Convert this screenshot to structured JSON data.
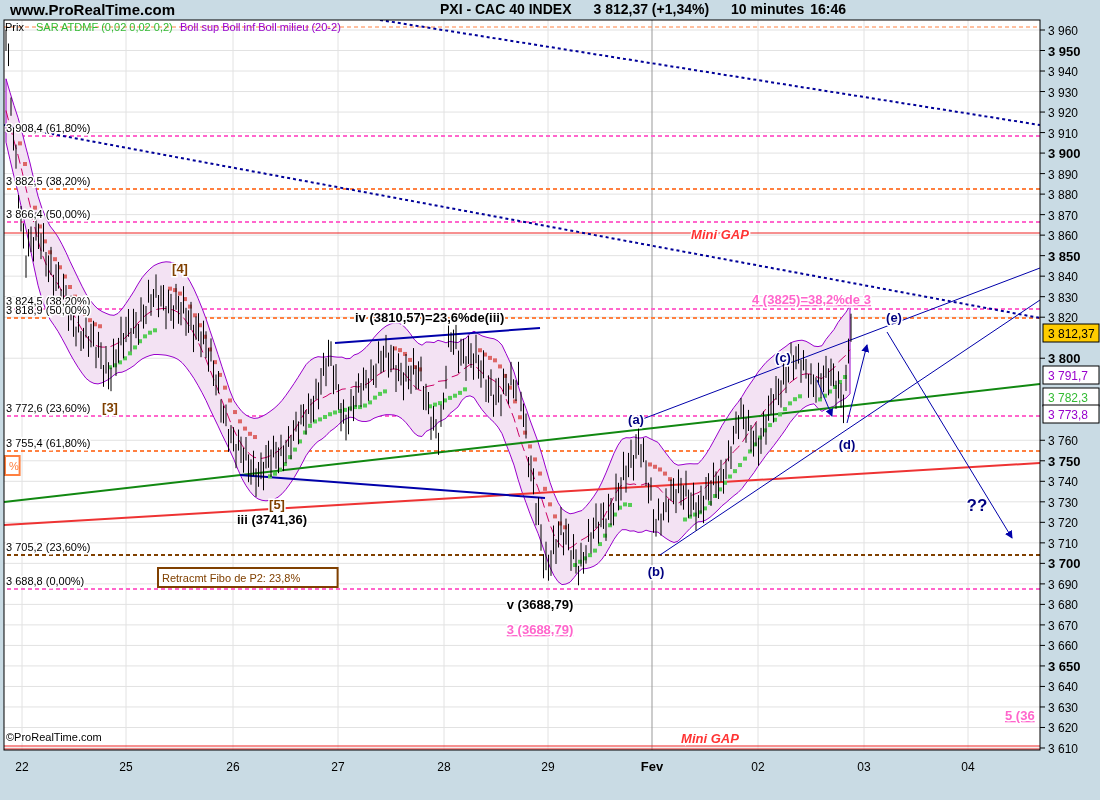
{
  "header": {
    "site": "www.ProRealTime.com",
    "title": "PXI - CAC 40 INDEX",
    "price": "3 812,37 (+1,34%)",
    "interval": "10 minutes",
    "time": "16:46"
  },
  "legend": {
    "price": "Prix",
    "sar": "SAR ATDMF (0,02 0,02 0,2)",
    "bollinger": "Boll sup Boll inf Boll milieu (20-2)"
  },
  "y_axis": [
    {
      "label": "3 960",
      "major": false
    },
    {
      "label": "3 950",
      "major": true
    },
    {
      "label": "3 940",
      "major": false
    },
    {
      "label": "3 930",
      "major": false
    },
    {
      "label": "3 920",
      "major": false
    },
    {
      "label": "3 910",
      "major": false
    },
    {
      "label": "3 900",
      "major": true
    },
    {
      "label": "3 890",
      "major": false
    },
    {
      "label": "3 880",
      "major": false
    },
    {
      "label": "3 870",
      "major": false
    },
    {
      "label": "3 860",
      "major": false
    },
    {
      "label": "3 850",
      "major": true
    },
    {
      "label": "3 840",
      "major": false
    },
    {
      "label": "3 830",
      "major": false
    },
    {
      "label": "3 820",
      "major": false
    },
    {
      "label": "3 800",
      "major": true
    },
    {
      "label": "3 760",
      "major": false
    },
    {
      "label": "3 750",
      "major": true
    },
    {
      "label": "3 740",
      "major": false
    },
    {
      "label": "3 730",
      "major": false
    },
    {
      "label": "3 720",
      "major": false
    },
    {
      "label": "3 710",
      "major": false
    },
    {
      "label": "3 700",
      "major": true
    },
    {
      "label": "3 690",
      "major": false
    },
    {
      "label": "3 680",
      "major": false
    },
    {
      "label": "3 670",
      "major": false
    },
    {
      "label": "3 660",
      "major": false
    },
    {
      "label": "3 650",
      "major": true
    },
    {
      "label": "3 640",
      "major": false
    },
    {
      "label": "3 630",
      "major": false
    },
    {
      "label": "3 620",
      "major": false
    },
    {
      "label": "3 610",
      "major": false
    }
  ],
  "x_axis": [
    {
      "label": "22",
      "major": false
    },
    {
      "label": "25",
      "major": false
    },
    {
      "label": "26",
      "major": false
    },
    {
      "label": "27",
      "major": false
    },
    {
      "label": "28",
      "major": false
    },
    {
      "label": "29",
      "major": false
    },
    {
      "label": "Fev",
      "major": true
    },
    {
      "label": "02",
      "major": false
    },
    {
      "label": "03",
      "major": false
    },
    {
      "label": "04",
      "major": false
    }
  ],
  "price_tags": [
    {
      "text": "3 812,37",
      "kind": "last"
    },
    {
      "text": "3 791,7",
      "kind": "bollinger"
    },
    {
      "text": "3 782,3",
      "kind": "sar"
    },
    {
      "text": "3 773,8",
      "kind": "bollinger"
    }
  ],
  "fibo_levels": [
    {
      "label": "3 908,4 (61,80%)",
      "color": "#ff66cc"
    },
    {
      "label": "3 882,5 (38,20%)",
      "color": "#ff8040"
    },
    {
      "label": "3 866,4 (50,00%)",
      "color": "#ff66cc"
    },
    {
      "label": "3 824,5 (38,20%)",
      "color": "#ff66cc"
    },
    {
      "label": "3 818,9 (50,00%)",
      "color": "#ff8040"
    },
    {
      "label": "3 772,6 (23,60%)",
      "color": "#ff66cc"
    },
    {
      "label": "3 755,4 (61,80%)",
      "color": "#ff8040"
    },
    {
      "label": "3 705,2 (23,60%)",
      "color": "#804000"
    },
    {
      "label": "3 688,8 (0,00%)",
      "color": "#ff66cc"
    }
  ],
  "annotations": [
    {
      "text": "[4]",
      "color": "#804000",
      "kind": "wave"
    },
    {
      "text": "[3]",
      "color": "#804000",
      "kind": "wave"
    },
    {
      "text": "[5]",
      "color": "#804000",
      "kind": "wave"
    },
    {
      "text": "iv (3810,57)=23,6%de(iii)",
      "color": "#000000",
      "kind": "wave"
    },
    {
      "text": "iii (3741,36)",
      "color": "#000000",
      "kind": "wave"
    },
    {
      "text": "v (3688,79)",
      "color": "#000000",
      "kind": "wave"
    },
    {
      "text": "3 (3688,79)",
      "color": "#ff66cc",
      "kind": "target"
    },
    {
      "text": "4 (3825)=38,2%de 3",
      "color": "#ff66cc",
      "kind": "target"
    },
    {
      "text": "(a)",
      "color": "#000080",
      "kind": "wave"
    },
    {
      "text": "(b)",
      "color": "#000080",
      "kind": "wave"
    },
    {
      "text": "(c)",
      "color": "#000080",
      "kind": "wave"
    },
    {
      "text": "(d)",
      "color": "#000080",
      "kind": "wave"
    },
    {
      "text": "(e)",
      "color": "#000080",
      "kind": "wave"
    },
    {
      "text": "??",
      "color": "#000080",
      "kind": "question"
    },
    {
      "text": "Mini GAP",
      "color": "#ff3333",
      "kind": "gap"
    },
    {
      "text": "Mini GAP",
      "color": "#ff3333",
      "kind": "gap"
    },
    {
      "text": "Retracmt Fibo de P2: 23,8%",
      "color": "#804000",
      "kind": "boxed"
    },
    {
      "text": "5 (36",
      "color": "#ff66cc",
      "kind": "target"
    },
    {
      "text": "%",
      "color": "#ff8040",
      "kind": "boxed"
    },
    {
      "text": "©ProRealTime.com",
      "color": "#000000",
      "kind": "plain"
    }
  ]
}
